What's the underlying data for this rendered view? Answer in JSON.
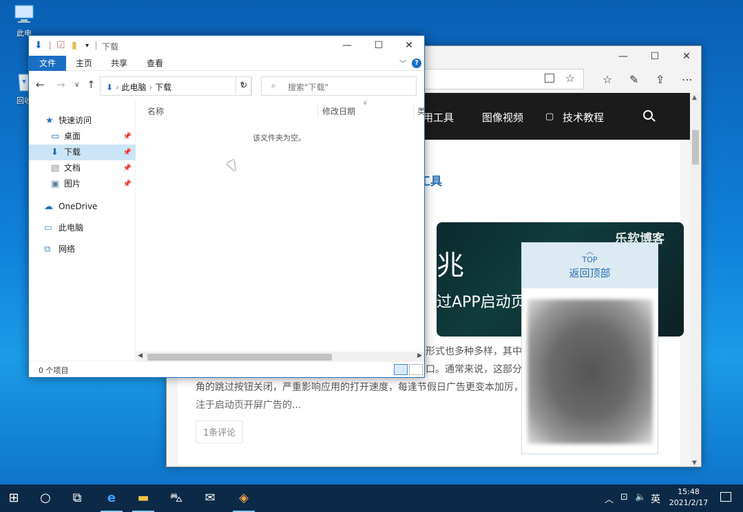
{
  "desktop": {
    "icons": [
      {
        "label": "此电",
        "icon": "this-pc-icon"
      },
      {
        "label": "回收",
        "icon": "recycle-bin-icon"
      }
    ]
  },
  "browser": {
    "window_controls": [
      "—",
      "☐",
      "✕"
    ],
    "nav_items": [
      "用工具",
      "图像视频",
      "技术教程"
    ],
    "post_title_fragment": "工具",
    "banner": {
      "big_text": "兆",
      "sub_text": "过APP启动页广",
      "brand": "乐软博客"
    },
    "excerpt_lines": [
      "形式也多种多样，其中",
      "口。通常来说，这部分",
      "角的跳过按钮关闭，严重影响应用的打开速度，每逢节假日广告更变本加厉，",
      "注于启动页开屏广告的..."
    ],
    "comment_button": "1条评论",
    "back_to_top": {
      "top_label": "TOP",
      "label": "返回顶部"
    }
  },
  "explorer": {
    "title": "下载",
    "ribbon_tabs": [
      "文件",
      "主页",
      "共享",
      "查看"
    ],
    "address": {
      "root": "此电脑",
      "current": "下载"
    },
    "search_placeholder": "搜索\"下载\"",
    "sidebar": {
      "quick_access": "快速访问",
      "pinned": [
        "桌面",
        "下载",
        "文档",
        "图片"
      ],
      "onedrive": "OneDrive",
      "this_pc": "此电脑",
      "network": "网络"
    },
    "columns": [
      "名称",
      "修改日期",
      "类"
    ],
    "empty_message": "该文件夹为空。",
    "status": "0 个项目"
  },
  "taskbar": {
    "ime": "英",
    "time": "15:48",
    "date": "2021/2/17"
  },
  "colors": {
    "accent": "#1a6ec3",
    "site_nav": "#1b1b1b",
    "link": "#2a6fb2"
  }
}
